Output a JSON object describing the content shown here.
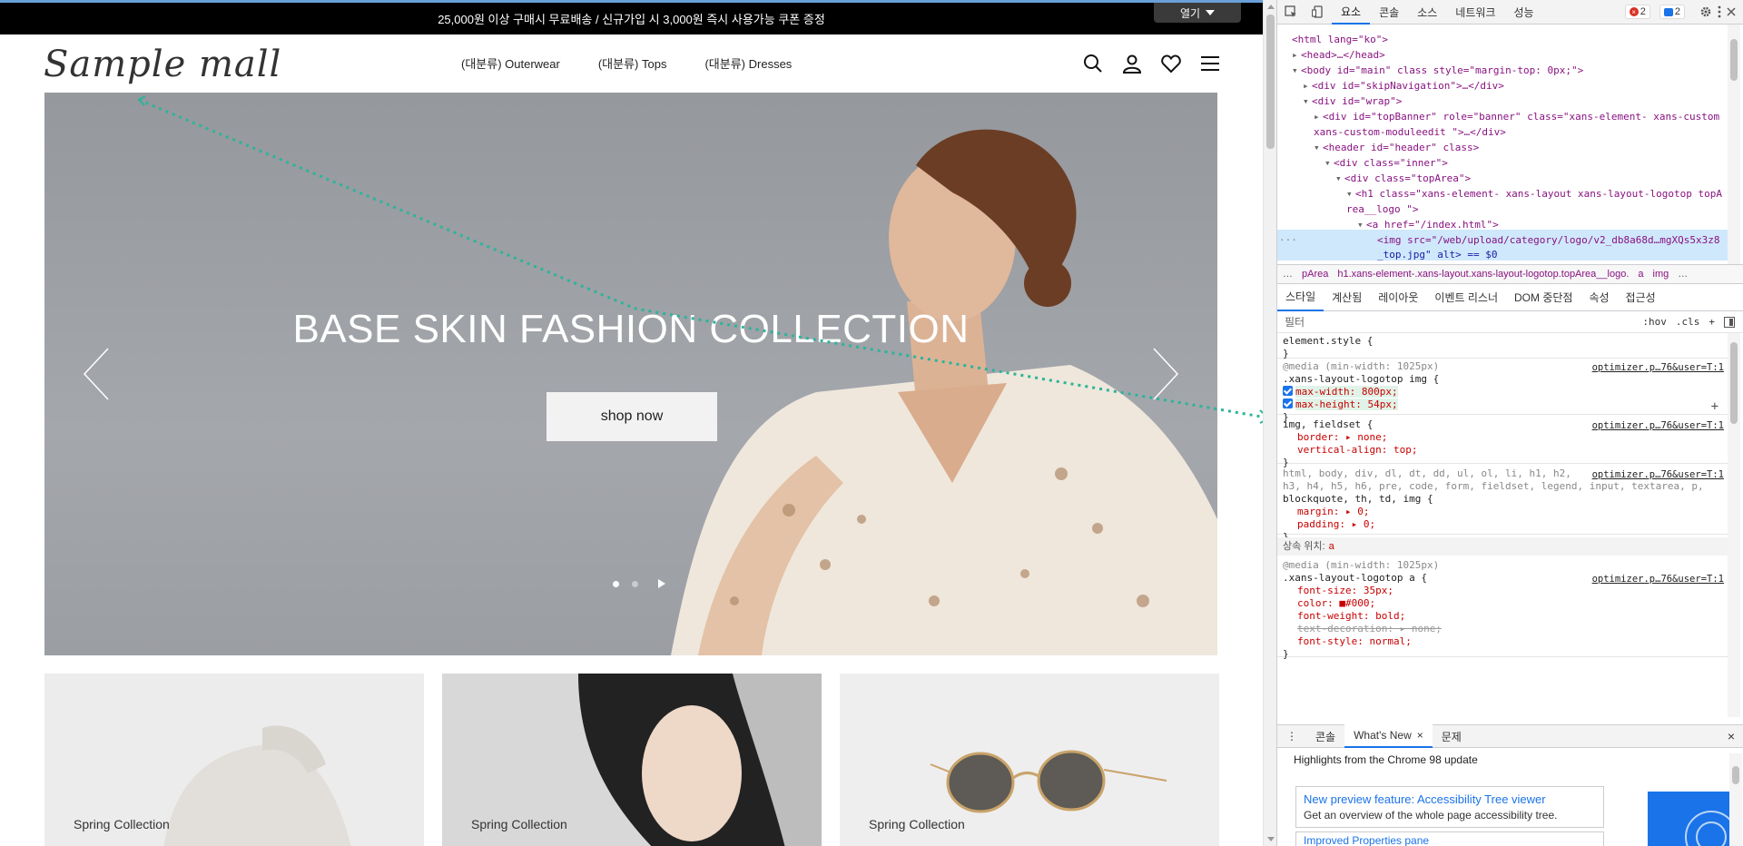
{
  "site": {
    "top_banner": "25,000원 이상 구매시 무료배송 / 신규가입 시 3,000원 즉시 사용가능 쿠폰 증정",
    "open_button": "열기",
    "logo": "Sample mall",
    "nav": [
      "(대분류) Outerwear",
      "(대분류) Tops",
      "(대분류) Dresses"
    ],
    "header_icons": [
      "search-icon",
      "user-icon",
      "heart-icon",
      "menu-icon"
    ],
    "hero": {
      "title": "BASE SKIN FASHION COLLECTION",
      "button": "shop now",
      "slide_count": 2,
      "active_slide": 1
    },
    "cards": [
      {
        "label": "Spring Collection"
      },
      {
        "label": "Spring Collection"
      },
      {
        "label": "Spring Collection"
      }
    ]
  },
  "devtools": {
    "tabs": [
      "요소",
      "콘솔",
      "소스",
      "네트워크",
      "성능"
    ],
    "active_tab": "요소",
    "error_count": "2",
    "message_count": "2",
    "dom": {
      "html": "<html lang=\"ko\">",
      "head": "<head>…</head>",
      "body": "<body id=\"main\" class style=\"margin-top: 0px;\">",
      "skip": "<div id=\"skipNavigation\">…</div>",
      "wrap": "<div id=\"wrap\">",
      "topbanner_1": "<div id=\"topBanner\" role=\"banner\" class=\"xans-element- xans-custom",
      "topbanner_2": "xans-custom-moduleedit \">…</div>",
      "header": "<header id=\"header\" class>",
      "inner": "<div class=\"inner\">",
      "toparea": "<div class=\"topArea\">",
      "h1_1": "<h1 class=\"xans-element- xans-layout xans-layout-logotop topA",
      "h1_2": "rea__logo \">",
      "a": "<a href=\"/index.html\">",
      "img_1": "<img src=\"/web/upload/category/logo/v2_db8a68d…mgXQs5x3z8",
      "img_2": "_top.jpg\" alt> == $0"
    },
    "breadcrumbs": [
      "…",
      "pArea",
      "h1.xans-element-.xans-layout.xans-layout-logotop.topArea__logo.",
      "a",
      "img",
      "…"
    ],
    "sub_tabs": [
      "스타일",
      "계산됨",
      "레이아웃",
      "이벤트 리스너",
      "DOM 중단점",
      "속성",
      "접근성"
    ],
    "active_sub_tab": "스타일",
    "filter_placeholder": "필터",
    "filter_tools": [
      ":hov",
      ".cls",
      "+"
    ],
    "styles": {
      "element_style": "element.style {",
      "close": "}",
      "media1": "@media (min-width: 1025px)",
      "sel1": ".xans-layout-logotop img {",
      "src1": "optimizer.p…76&user=T:1",
      "p1": "max-width: 800px;",
      "p2": "max-height: 54px;",
      "sel2": "img, fieldset {",
      "src2": "optimizer.p…76&user=T:1",
      "p3": "border: ▸ none;",
      "p4": "vertical-align: top;",
      "sel3a": "html, body, div, dl, dt, dd, ul, ol, li, h1, h2,",
      "sel3b": "h3, h4, h5, h6, pre, code, form, fieldset, legend, input, textarea, p,",
      "sel3c": "blockquote, th, td, img {",
      "src3": "optimizer.p…76&user=T:1",
      "p5": "margin: ▸ 0;",
      "p6": "padding: ▸ 0;",
      "inherit_label": "상속 위치:",
      "inherit_from": "a",
      "media2": "@media (min-width: 1025px)",
      "sel4": ".xans-layout-logotop a {",
      "src4": "optimizer.p…76&user=T:1",
      "p7": "font-size: 35px;",
      "p8": "color: ■#000;",
      "p9": "font-weight: bold;",
      "p10": "text-decoration: ▸ none;",
      "p11": "font-style: normal;"
    },
    "drawer_tabs": [
      "콘솔",
      "What's New",
      "문제"
    ],
    "active_drawer_tab": "What's New",
    "highlights": "Highlights from the Chrome 98 update",
    "whats_new_title": "New preview feature: Accessibility Tree viewer",
    "whats_new_desc": "Get an overview of the whole page accessibility tree.",
    "whats_new_next": "Improved Properties pane"
  },
  "colors": {
    "accent": "#1a73e8",
    "guide": "#2bb59a"
  }
}
